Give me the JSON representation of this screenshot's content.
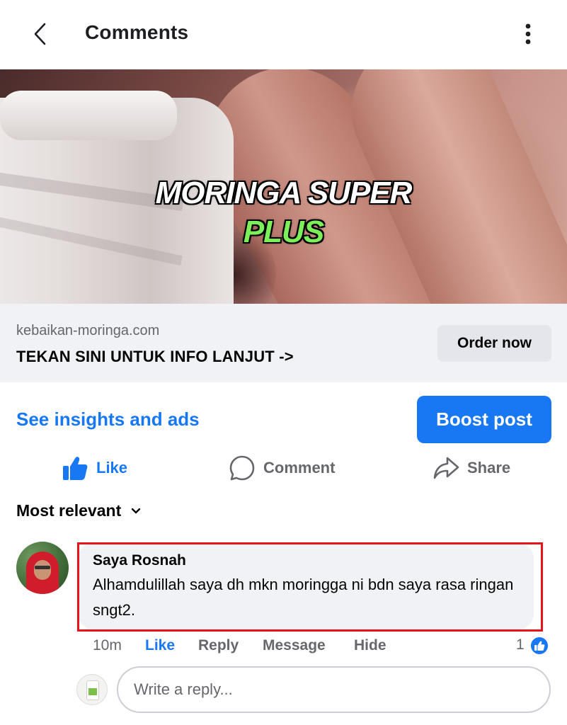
{
  "header": {
    "title": "Comments"
  },
  "media": {
    "overlay_title": "MORINGA SUPER",
    "overlay_subtitle": "PLUS"
  },
  "link_preview": {
    "domain": "kebaikan-moringa.com",
    "headline": "TEKAN SINI UNTUK INFO LANJUT ->",
    "cta_label": "Order now"
  },
  "insights": {
    "link_label": "See insights and ads",
    "boost_label": "Boost post"
  },
  "actions": {
    "like_label": "Like",
    "comment_label": "Comment",
    "share_label": "Share"
  },
  "sort": {
    "label": "Most relevant"
  },
  "comment": {
    "author": "Saya Rosnah",
    "text": "Alhamdulillah saya dh mkn moringga ni bdn saya rasa ringan sngt2.",
    "time": "10m",
    "like_label": "Like",
    "reply_label": "Reply",
    "message_label": "Message",
    "hide_label": "Hide",
    "reaction_count": "1"
  },
  "reply_box": {
    "placeholder": "Write a reply..."
  },
  "colors": {
    "accent": "#1877f2",
    "highlight_border": "#e6131b",
    "muted_text": "#65676b"
  }
}
